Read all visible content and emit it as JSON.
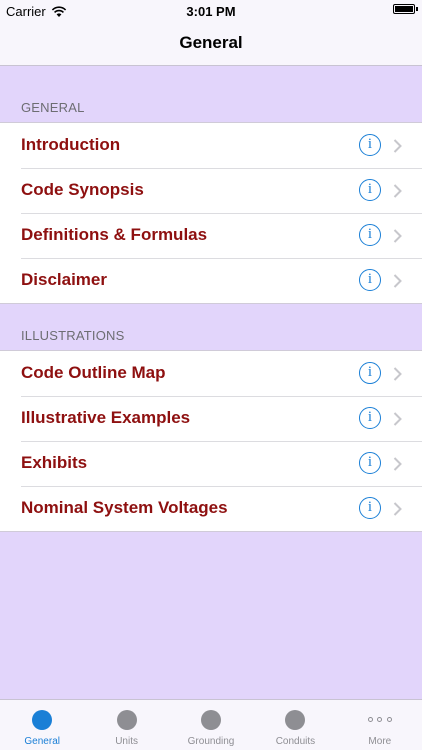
{
  "status_bar": {
    "carrier": "Carrier",
    "time": "3:01 PM"
  },
  "nav": {
    "title": "General"
  },
  "sections": [
    {
      "header": "GENERAL",
      "rows": [
        {
          "label": "Introduction"
        },
        {
          "label": "Code Synopsis"
        },
        {
          "label": "Definitions & Formulas"
        },
        {
          "label": "Disclaimer"
        }
      ]
    },
    {
      "header": "ILLUSTRATIONS",
      "rows": [
        {
          "label": "Code Outline Map"
        },
        {
          "label": "Illustrative Examples"
        },
        {
          "label": "Exhibits"
        },
        {
          "label": "Nominal System Voltages"
        }
      ]
    }
  ],
  "info_glyph": "i",
  "tabs": [
    {
      "label": "General",
      "active": true,
      "icon": "circle-icon"
    },
    {
      "label": "Units",
      "active": false,
      "icon": "circle-icon"
    },
    {
      "label": "Grounding",
      "active": false,
      "icon": "circle-icon"
    },
    {
      "label": "Conduits",
      "active": false,
      "icon": "circle-icon"
    },
    {
      "label": "More",
      "active": false,
      "icon": "more-icon"
    }
  ],
  "colors": {
    "background": "#e2d5fb",
    "row_label": "#8e1010",
    "accent": "#1a7fd6",
    "inactive": "#8e8e93"
  }
}
